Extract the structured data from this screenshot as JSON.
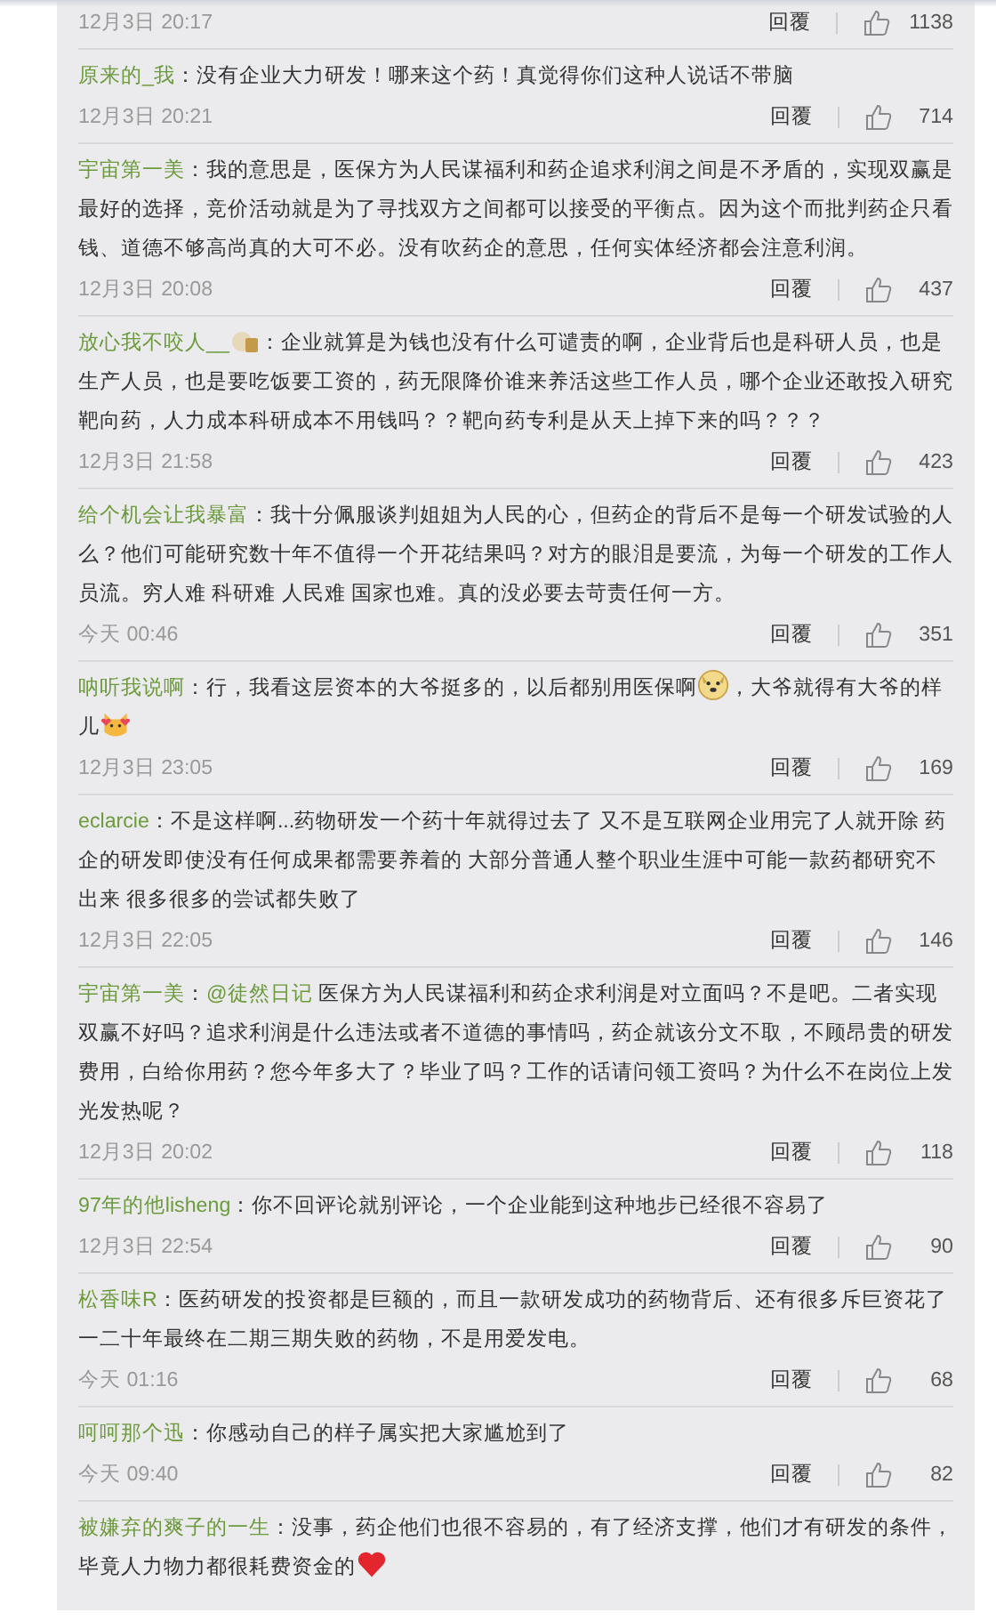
{
  "comments": [
    {
      "time": "12月3日 20:17",
      "reply": "回覆",
      "likes": "1138"
    },
    {
      "user": "原来的_我",
      "segments": [
        {
          "kind": "text",
          "text": "：没有企业大力研发！哪来这个药！真觉得你们这种人说话不带脑"
        }
      ],
      "time": "12月3日 20:21",
      "reply": "回覆",
      "likes": "714"
    },
    {
      "user": "宇宙第一美",
      "segments": [
        {
          "kind": "text",
          "text": "：我的意思是，医保方为人民谋福利和药企追求利润之间是不矛盾的，实现双赢是最好的选择，竞价活动就是为了寻找双方之间都可以接受的平衡点。因为这个而批判药企只看钱、道德不够高尚真的大可不必。没有吹药企的意思，任何实体经济都会注意利润。"
        }
      ],
      "time": "12月3日 20:08",
      "reply": "回覆",
      "likes": "437"
    },
    {
      "user": "放心我不咬人__",
      "badge": true,
      "segments": [
        {
          "kind": "text",
          "text": "：企业就算是为钱也没有什么可谴责的啊，企业背后也是科研人员，也是生产人员，也是要吃饭要工资的，药无限降价谁来养活这些工作人员，哪个企业还敢投入研究靶向药，人力成本科研成本不用钱吗？？靶向药专利是从天上掉下来的吗？？？"
        }
      ],
      "time": "12月3日 21:58",
      "reply": "回覆",
      "likes": "423"
    },
    {
      "user": "给个机会让我暴富",
      "segments": [
        {
          "kind": "text",
          "text": "：我十分佩服谈判姐姐为人民的心，但药企的背后不是每一个研发试验的人么？他们可能研究数十年不值得一个开花结果吗？对方的眼泪是要流，为每一个研发的工作人员流。穷人难 科研难 人民难 国家也难。真的没必要去苛责任何一方。"
        }
      ],
      "time": "今天 00:46",
      "reply": "回覆",
      "likes": "351"
    },
    {
      "user": "呐听我说啊",
      "segments": [
        {
          "kind": "text",
          "text": "：行，我看这层资本的大爷挺多的，以后都别用医保啊"
        },
        {
          "kind": "dog"
        },
        {
          "kind": "text",
          "text": "，大爷就得有大爷的样儿"
        },
        {
          "kind": "cat"
        }
      ],
      "time": "12月3日 23:05",
      "reply": "回覆",
      "likes": "169"
    },
    {
      "user": "eclarcie",
      "segments": [
        {
          "kind": "text",
          "text": "：不是这样啊...药物研发一个药十年就得过去了 又不是互联网企业用完了人就开除 药企的研发即使没有任何成果都需要养着的 大部分普通人整个职业生涯中可能一款药都研究不出来 很多很多的尝试都失败了"
        }
      ],
      "time": "12月3日 22:05",
      "reply": "回覆",
      "likes": "146"
    },
    {
      "user": "宇宙第一美",
      "segments": [
        {
          "kind": "text",
          "text": "："
        },
        {
          "kind": "mention",
          "text": "@徒然日记"
        },
        {
          "kind": "text",
          "text": " 医保方为人民谋福利和药企求利润是对立面吗？不是吧。二者实现双赢不好吗？追求利润是什么违法或者不道德的事情吗，药企就该分文不取，不顾昂贵的研发费用，白给你用药？您今年多大了？毕业了吗？工作的话请问领工资吗？为什么不在岗位上发光发热呢？"
        }
      ],
      "time": "12月3日 20:02",
      "reply": "回覆",
      "likes": "118"
    },
    {
      "user": "97年的他lisheng",
      "segments": [
        {
          "kind": "text",
          "text": "：你不回评论就别评论，一个企业能到这种地步已经很不容易了"
        }
      ],
      "time": "12月3日 22:54",
      "reply": "回覆",
      "likes": "90"
    },
    {
      "user": "松香味R",
      "segments": [
        {
          "kind": "text",
          "text": "：医药研发的投资都是巨额的，而且一款研发成功的药物背后、还有很多斥巨资花了一二十年最终在二期三期失败的药物，不是用爱发电。"
        }
      ],
      "time": "今天 01:16",
      "reply": "回覆",
      "likes": "68"
    },
    {
      "user": "呵呵那个迅",
      "segments": [
        {
          "kind": "text",
          "text": "：你感动自己的样子属实把大家尴尬到了"
        }
      ],
      "time": "今天 09:40",
      "reply": "回覆",
      "likes": "82"
    },
    {
      "user": "被嫌弃的爽子的一生",
      "segments": [
        {
          "kind": "text",
          "text": "：没事，药企他们也很不容易的，有了经济支撑，他们才有研发的条件，毕竟人力物力都很耗费资金的"
        },
        {
          "kind": "heart"
        }
      ]
    }
  ]
}
